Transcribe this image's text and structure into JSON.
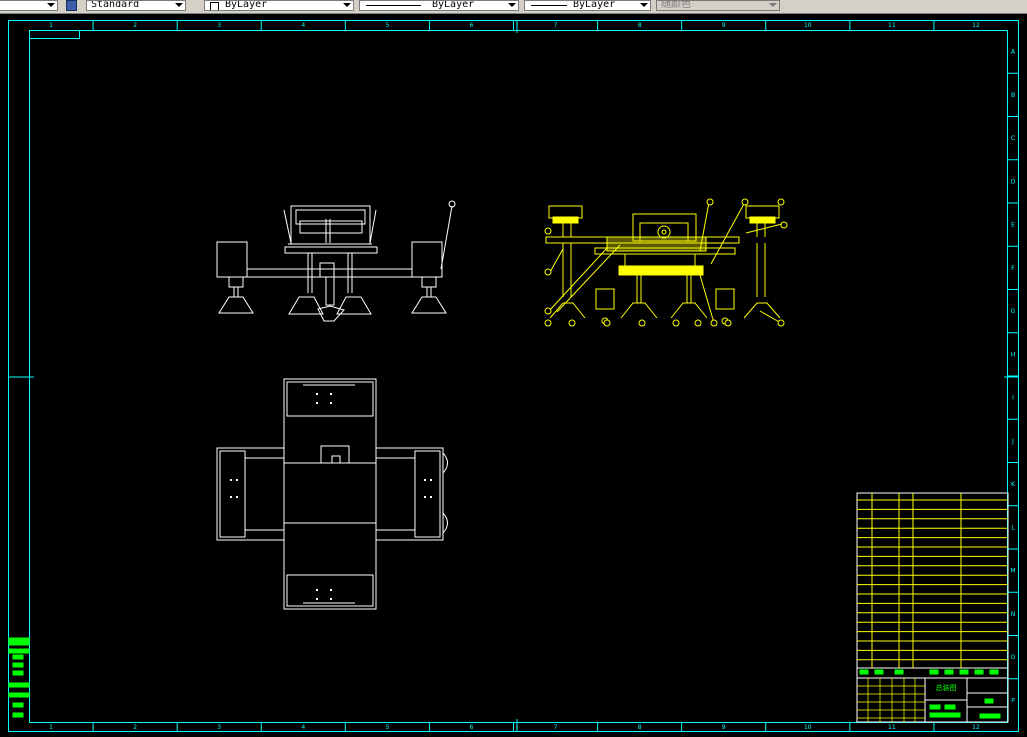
{
  "toolbar": {
    "text_style_value": "Standard",
    "color_value": "ByLayer",
    "linetype_value": "ByLayer",
    "lineweight_value": "ByLayer",
    "plotstyle_value": "随颜色"
  },
  "frame": {
    "column_labels": [
      "1",
      "2",
      "3",
      "4",
      "5",
      "6",
      "7",
      "8",
      "9",
      "10",
      "11",
      "12"
    ],
    "row_labels": [
      "A",
      "B",
      "C",
      "D",
      "E",
      "F",
      "G",
      "H",
      "I",
      "J",
      "K",
      "L",
      "M",
      "N",
      "O",
      "P"
    ]
  },
  "title_block": {
    "drawing_name": "总装图"
  },
  "colors": {
    "frame": "#00ffff",
    "geometry": "#ffffff",
    "highlight": "#ffff00",
    "title_text": "#00ff00"
  }
}
